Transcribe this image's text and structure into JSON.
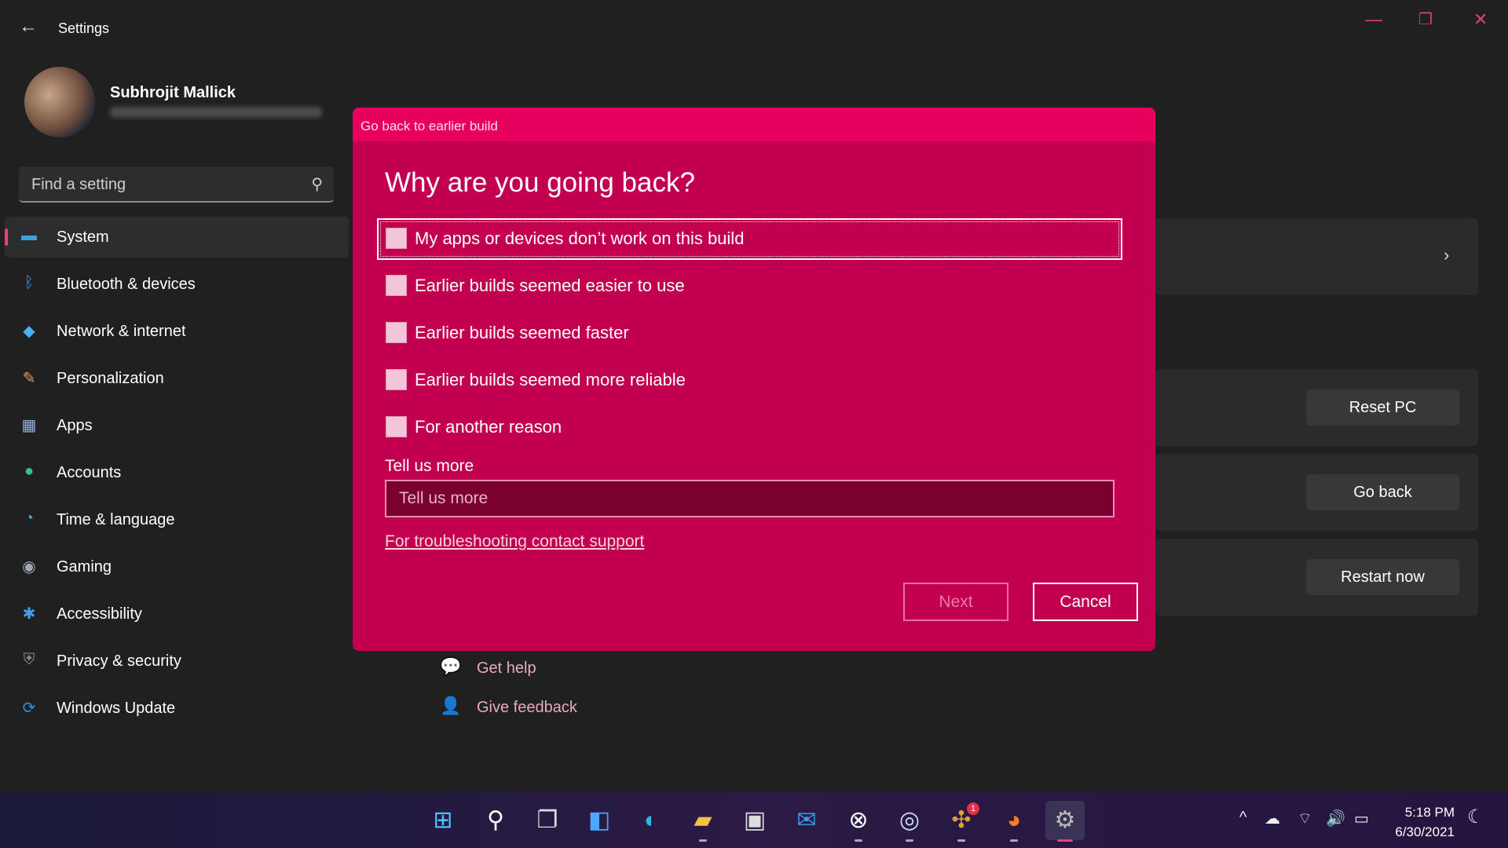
{
  "window": {
    "title": "Settings",
    "back_icon": "arrow-left-icon",
    "controls": [
      "minimize-icon",
      "restore-icon",
      "close-icon"
    ]
  },
  "user": {
    "name": "Subhrojit Mallick"
  },
  "search": {
    "placeholder": "Find a setting"
  },
  "sidebar": {
    "items": [
      {
        "label": "System",
        "icon": "system-icon",
        "color": "#3aa0e0"
      },
      {
        "label": "Bluetooth & devices",
        "icon": "bluetooth-icon",
        "color": "#3a8fe8"
      },
      {
        "label": "Network & internet",
        "icon": "wifi-icon",
        "color": "#4ab0f0"
      },
      {
        "label": "Personalization",
        "icon": "brush-icon",
        "color": "#e0a050"
      },
      {
        "label": "Apps",
        "icon": "apps-icon",
        "color": "#8fb0d8"
      },
      {
        "label": "Accounts",
        "icon": "accounts-icon",
        "color": "#3ac090"
      },
      {
        "label": "Time & language",
        "icon": "clock-globe-icon",
        "color": "#40a8e8"
      },
      {
        "label": "Gaming",
        "icon": "gamepad-icon",
        "color": "#a0a8b8"
      },
      {
        "label": "Accessibility",
        "icon": "accessibility-icon",
        "color": "#40a0f0"
      },
      {
        "label": "Privacy & security",
        "icon": "shield-icon",
        "color": "#8890a0"
      },
      {
        "label": "Windows Update",
        "icon": "update-icon",
        "color": "#2a90e0"
      }
    ],
    "selected": "System"
  },
  "recovery": {
    "buttons": {
      "reset": "Reset PC",
      "go_back": "Go back",
      "restart": "Restart now"
    }
  },
  "help": {
    "get_help": "Get help",
    "give_feedback": "Give feedback"
  },
  "dialog": {
    "header": "Go back to earlier build",
    "title": "Why are you going back?",
    "options": [
      {
        "label": "My apps or devices don’t work on this build",
        "checked": false
      },
      {
        "label": "Earlier builds seemed easier to use",
        "checked": false
      },
      {
        "label": "Earlier builds seemed faster",
        "checked": false
      },
      {
        "label": "Earlier builds seemed more reliable",
        "checked": false
      },
      {
        "label": "For another reason",
        "checked": false
      }
    ],
    "tell_label": "Tell us more",
    "tell_placeholder": "Tell us more",
    "tell_value": "",
    "link": "For troubleshooting contact support",
    "next": "Next",
    "cancel": "Cancel",
    "accent": "#c2004f"
  },
  "taskbar": {
    "apps": [
      "start-icon",
      "search-icon",
      "task-view-icon",
      "widgets-icon",
      "edge-icon",
      "file-explorer-icon",
      "store-icon",
      "mail-icon",
      "xbox-icon",
      "steam-icon",
      "slack-icon",
      "firefox-icon",
      "settings-icon"
    ],
    "slack_badge": "1"
  },
  "tray": {
    "time": "5:18 PM",
    "date": "6/30/2021"
  }
}
